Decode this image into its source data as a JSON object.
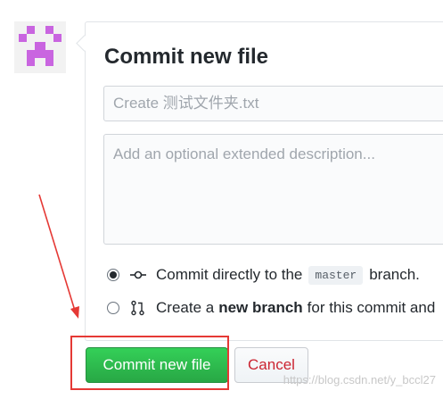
{
  "form": {
    "title": "Commit new file",
    "summary_placeholder": "Create 测试文件夹.txt",
    "description_placeholder": "Add an optional extended description...",
    "option_direct": {
      "prefix": "Commit directly to the",
      "branch": "master",
      "suffix": "branch.",
      "selected": true
    },
    "option_new": {
      "prefix": "Create a",
      "bold": "new branch",
      "suffix": "for this commit and",
      "selected": false
    }
  },
  "buttons": {
    "commit": "Commit new file",
    "cancel": "Cancel"
  },
  "watermark": "https://blog.csdn.net/y_bccl27",
  "colors": {
    "commit_green": "#28a745",
    "cancel_red": "#cb2431",
    "highlight_red": "#e53935",
    "avatar_purple": "#c965e0"
  }
}
